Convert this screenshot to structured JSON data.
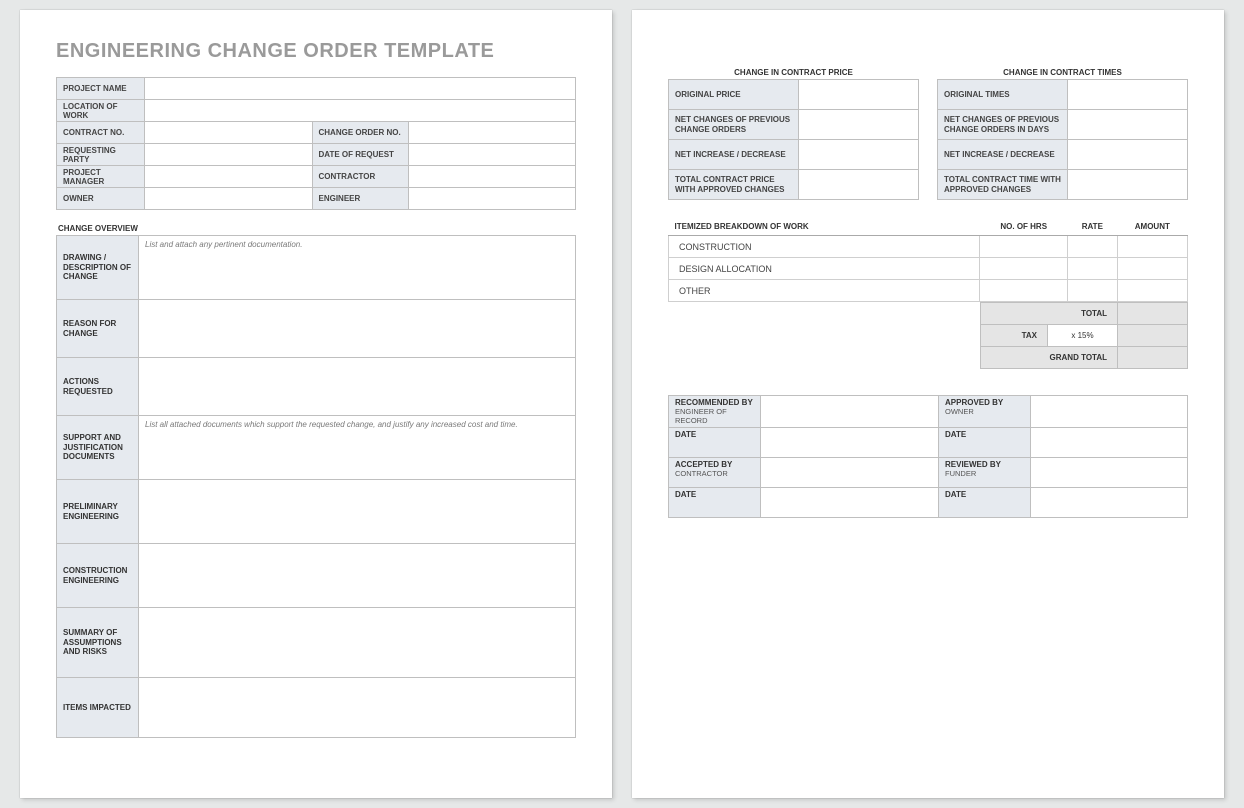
{
  "title": "ENGINEERING CHANGE ORDER TEMPLATE",
  "info": {
    "project_name": "PROJECT NAME",
    "location_of_work": "LOCATION OF WORK",
    "contract_no": "CONTRACT NO.",
    "change_order_no": "CHANGE ORDER NO.",
    "requesting_party": "REQUESTING PARTY",
    "date_of_request": "DATE OF REQUEST",
    "project_manager": "PROJECT MANAGER",
    "contractor": "CONTRACTOR",
    "owner": "OWNER",
    "engineer": "ENGINEER"
  },
  "overview_heading": "CHANGE OVERVIEW",
  "overview": {
    "drawing": {
      "label": "DRAWING / DESCRIPTION OF CHANGE",
      "hint": "List and attach any pertinent documentation."
    },
    "reason": {
      "label": "REASON FOR CHANGE",
      "hint": ""
    },
    "actions": {
      "label": "ACTIONS REQUESTED",
      "hint": ""
    },
    "support": {
      "label": "SUPPORT AND JUSTIFICATION DOCUMENTS",
      "hint": "List all attached documents which support the requested change, and justify any increased cost and time."
    },
    "prelim": {
      "label": "PRELIMINARY ENGINEERING",
      "hint": ""
    },
    "constr": {
      "label": "CONSTRUCTION ENGINEERING",
      "hint": ""
    },
    "summary": {
      "label": "SUMMARY OF ASSUMPTIONS AND RISKS",
      "hint": ""
    },
    "items": {
      "label": "ITEMS IMPACTED",
      "hint": ""
    }
  },
  "price": {
    "heading": "CHANGE IN CONTRACT PRICE",
    "original": "ORIGINAL PRICE",
    "net_prev": "NET CHANGES OF PREVIOUS CHANGE ORDERS",
    "net_inc": "NET INCREASE / DECREASE",
    "total": "TOTAL CONTRACT PRICE WITH APPROVED CHANGES"
  },
  "times": {
    "heading": "CHANGE IN CONTRACT TIMES",
    "original": "ORIGINAL TIMES",
    "net_prev": "NET CHANGES OF PREVIOUS CHANGE ORDERS IN DAYS",
    "net_inc": "NET INCREASE / DECREASE",
    "total": "TOTAL CONTRACT TIME WITH APPROVED CHANGES"
  },
  "itemized": {
    "heading": "ITEMIZED BREAKDOWN OF WORK",
    "col_hrs": "NO. OF HRS",
    "col_rate": "RATE",
    "col_amount": "AMOUNT",
    "rows": {
      "construction": "CONSTRUCTION",
      "design": "DESIGN ALLOCATION",
      "other": "OTHER"
    },
    "total": "TOTAL",
    "tax": "TAX",
    "tax_value": "x 15%",
    "grand_total": "GRAND TOTAL"
  },
  "signoff": {
    "recommended": {
      "main": "RECOMMENDED BY",
      "sub": "ENGINEER OF RECORD"
    },
    "approved": {
      "main": "APPROVED BY",
      "sub": "OWNER"
    },
    "accepted": {
      "main": "ACCEPTED BY",
      "sub": "CONTRACTOR"
    },
    "reviewed": {
      "main": "REVIEWED BY",
      "sub": "FUNDER"
    },
    "date": "DATE"
  }
}
